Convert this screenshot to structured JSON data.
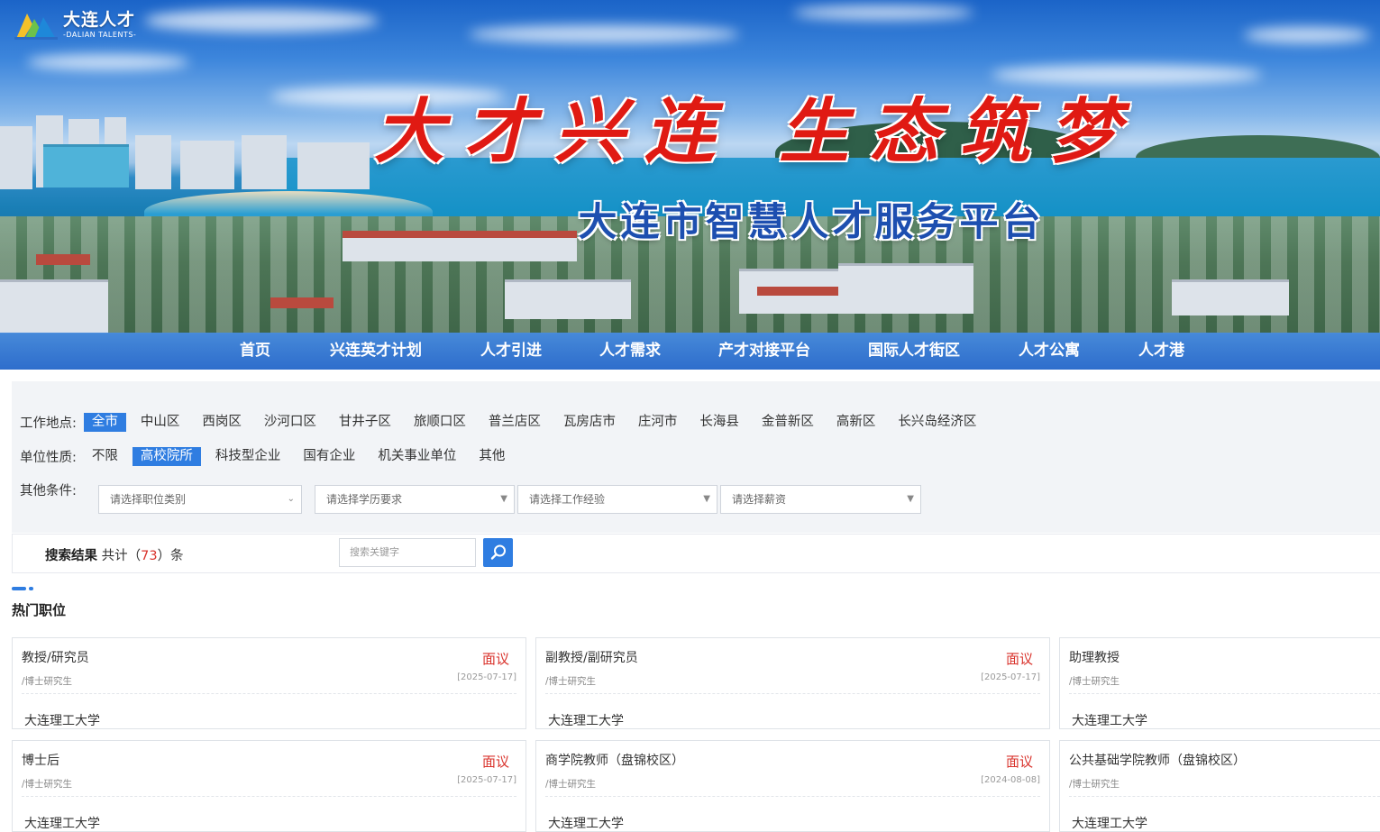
{
  "site": {
    "logo_cn": "大连人才",
    "logo_en": "-DALIAN TALENTS-",
    "slogan": "大才兴连 生态筑梦",
    "subtitle": "大连市智慧人才服务平台"
  },
  "nav": {
    "items": [
      "首页",
      "兴连英才计划",
      "人才引进",
      "人才需求",
      "产才对接平台",
      "国际人才街区",
      "人才公寓",
      "人才港"
    ]
  },
  "filters": {
    "location_label": "工作地点:",
    "locations": [
      "全市",
      "中山区",
      "西岗区",
      "沙河口区",
      "甘井子区",
      "旅顺口区",
      "普兰店区",
      "瓦房店市",
      "庄河市",
      "长海县",
      "金普新区",
      "高新区",
      "长兴岛经济区"
    ],
    "location_selected": "全市",
    "unit_label": "单位性质:",
    "units": [
      "不限",
      "高校院所",
      "科技型企业",
      "国有企业",
      "机关事业单位",
      "其他"
    ],
    "unit_selected": "高校院所",
    "other_label": "其他条件:",
    "selects": [
      {
        "placeholder": "请选择职位类别"
      },
      {
        "placeholder": "请选择学历要求"
      },
      {
        "placeholder": "请选择工作经验"
      },
      {
        "placeholder": "请选择薪资"
      }
    ]
  },
  "search": {
    "result_label": "搜索结果",
    "result_prefix": "共计（",
    "result_count": "73",
    "result_suffix": "）条",
    "placeholder": "搜索关键字"
  },
  "hot": {
    "title": "热门职位",
    "jobs": [
      {
        "title": "教授/研究员",
        "salary": "面议",
        "edu": "/博士研究生",
        "date": "[2025-07-17]",
        "company": "大连理工大学"
      },
      {
        "title": "副教授/副研究员",
        "salary": "面议",
        "edu": "/博士研究生",
        "date": "[2025-07-17]",
        "company": "大连理工大学"
      },
      {
        "title": "助理教授",
        "salary": "",
        "edu": "/博士研究生",
        "date": "",
        "company": "大连理工大学"
      },
      {
        "title": "博士后",
        "salary": "面议",
        "edu": "/博士研究生",
        "date": "[2025-07-17]",
        "company": "大连理工大学"
      },
      {
        "title": "商学院教师（盘锦校区）",
        "salary": "面议",
        "edu": "/博士研究生",
        "date": "[2024-08-08]",
        "company": "大连理工大学"
      },
      {
        "title": "公共基础学院教师（盘锦校区）",
        "salary": "",
        "edu": "/博士研究生",
        "date": "",
        "company": "大连理工大学"
      }
    ]
  },
  "colors": {
    "accent": "#2f7de1",
    "price": "#d9332c",
    "nav_bg": "#3a7fd8",
    "slogan": "#e01a13",
    "subtitle": "#1d4fb0"
  },
  "icons": {
    "search_button": "search-icon",
    "select_caret": "caret-down-icon",
    "logo": "dalian-talents-logo-icon"
  }
}
